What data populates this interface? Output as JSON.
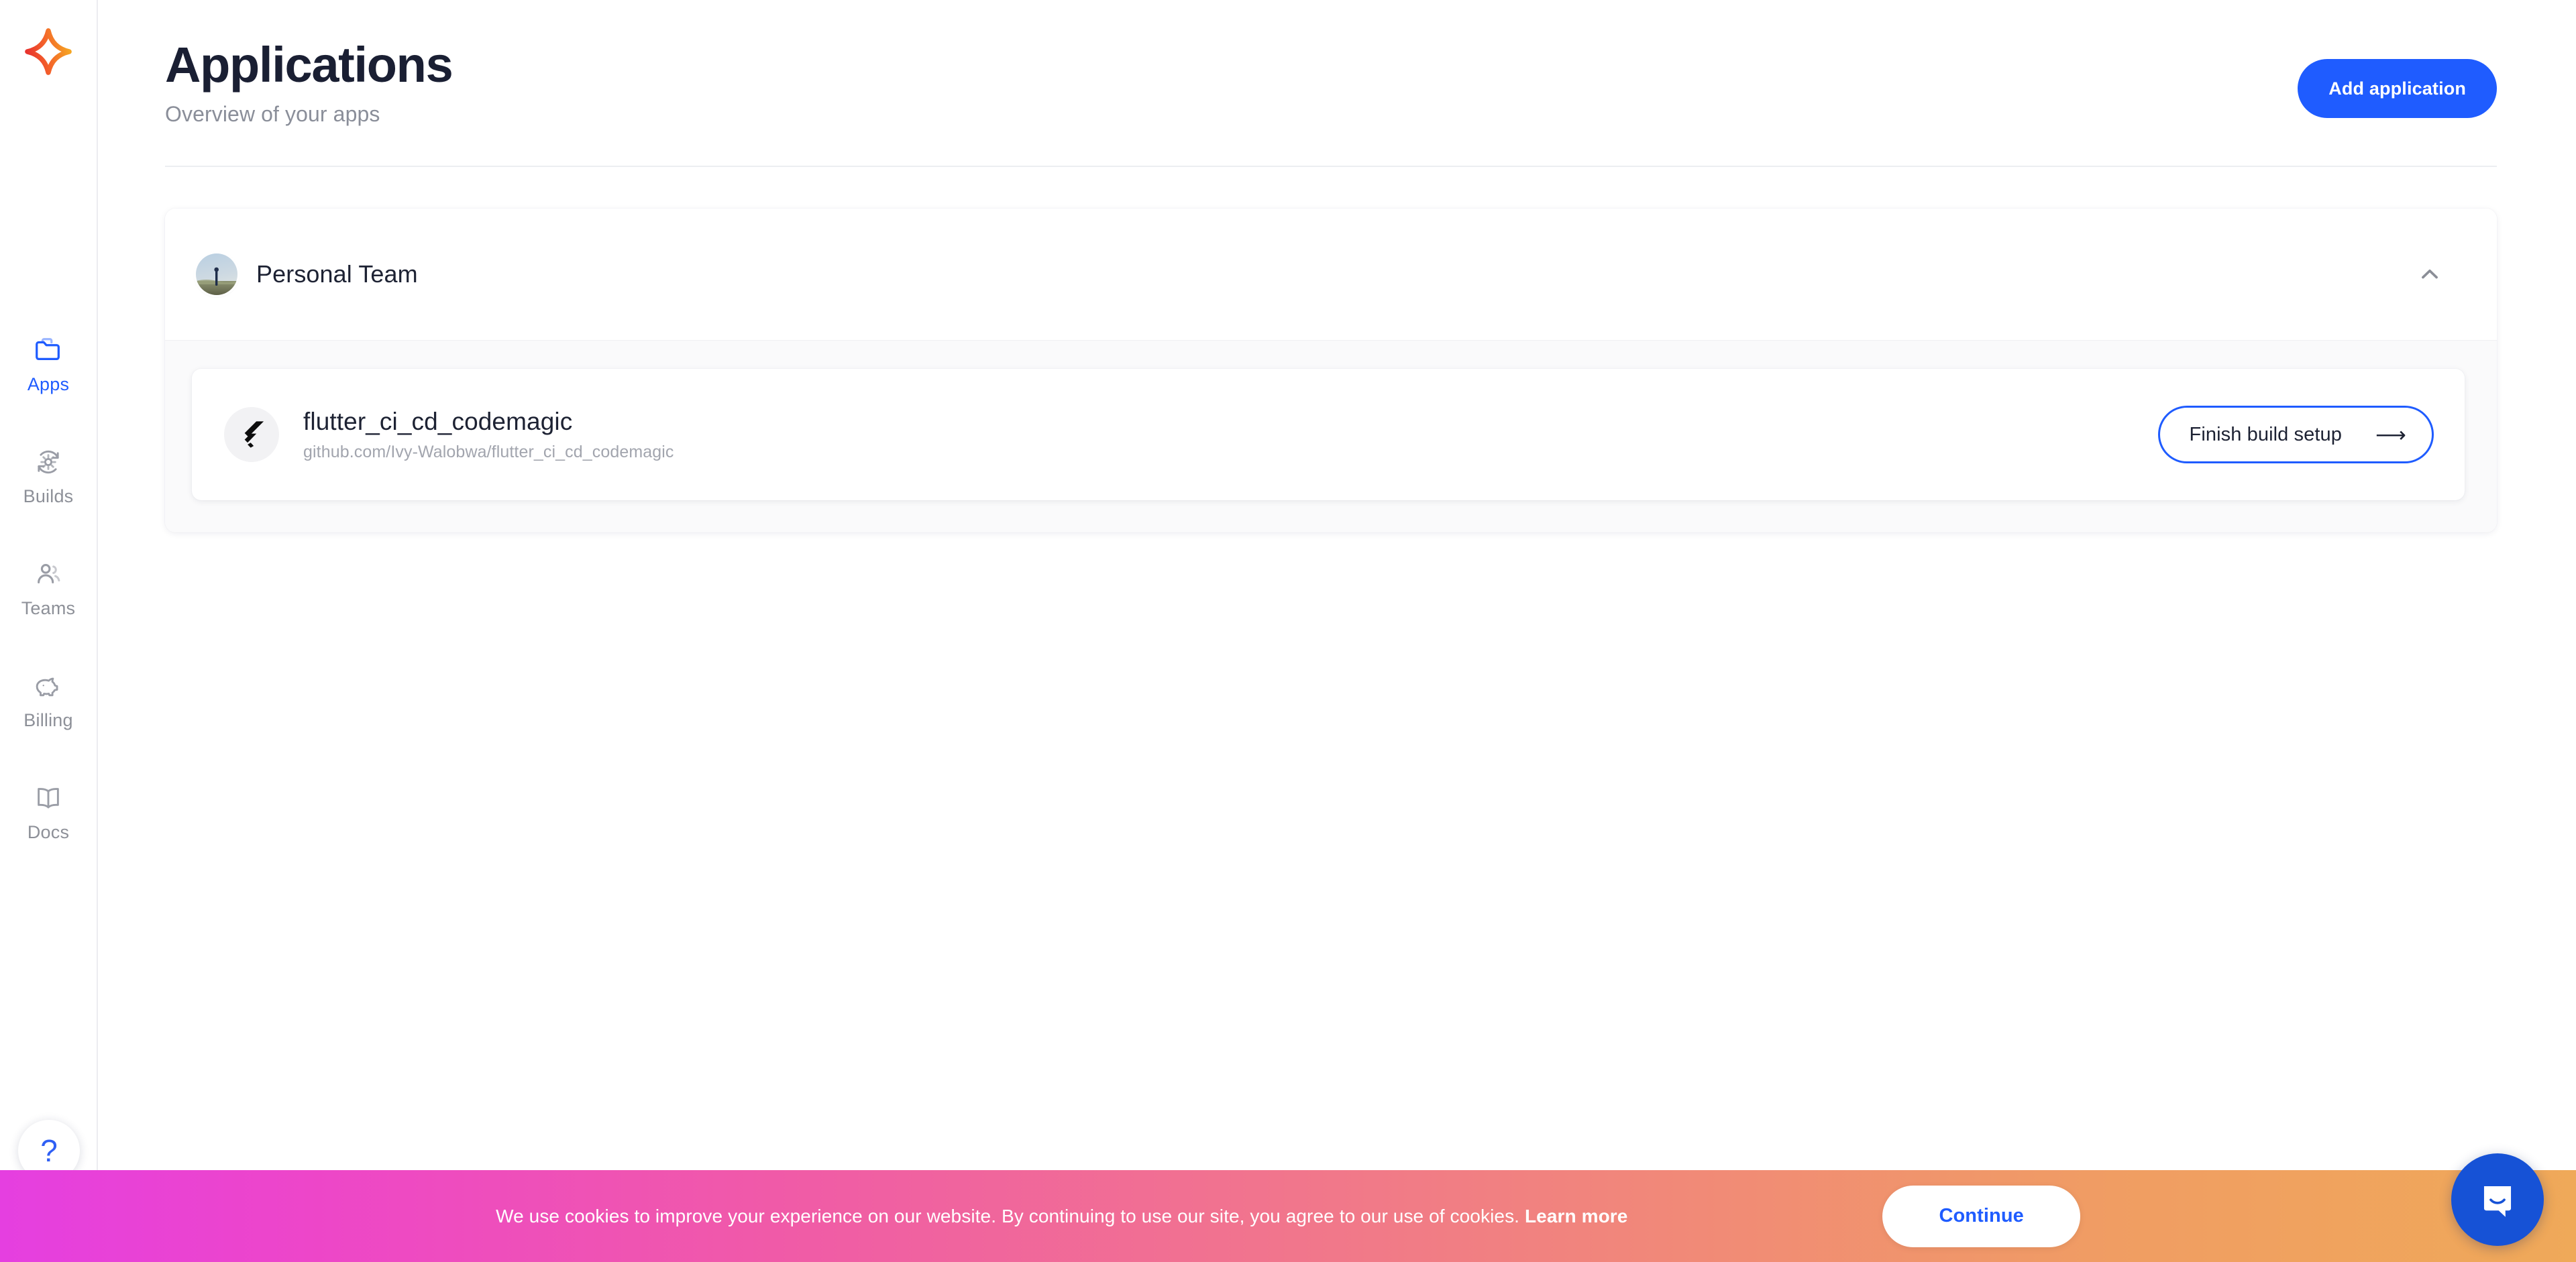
{
  "brand": {
    "logo_icon": "codemagic-star-logo",
    "colors": {
      "accent": "#1f5cff",
      "logo_start": "#e8342e",
      "logo_end": "#f5a623"
    }
  },
  "sidebar": {
    "items": [
      {
        "label": "Apps",
        "icon": "folder-icon",
        "active": true
      },
      {
        "label": "Builds",
        "icon": "gear-cycle-icon",
        "active": false
      },
      {
        "label": "Teams",
        "icon": "people-icon",
        "active": false
      },
      {
        "label": "Billing",
        "icon": "piggy-bank-icon",
        "active": false
      },
      {
        "label": "Docs",
        "icon": "open-book-icon",
        "active": false
      }
    ],
    "help": {
      "label": "?",
      "icon": "question-mark-icon"
    }
  },
  "header": {
    "title": "Applications",
    "subtitle": "Overview of your apps",
    "add_application_label": "Add application"
  },
  "teams": [
    {
      "name": "Personal Team",
      "avatar_icon": "team-avatar-photo",
      "expanded": true,
      "collapse_icon": "chevron-up-icon",
      "apps": [
        {
          "name": "flutter_ci_cd_codemagic",
          "repository_url": "github.com/Ivy-Walobwa/flutter_ci_cd_codemagic",
          "logo_icon": "flutter-icon",
          "action_label": "Finish build setup",
          "action_icon": "arrow-right-icon"
        }
      ]
    }
  ],
  "cookie_banner": {
    "message": "We use cookies to improve your experience on our website. By continuing to use our site, you agree to our use of cookies.",
    "link_label": "Learn more",
    "continue_label": "Continue"
  },
  "chat_widget": {
    "icon": "intercom-chat-icon"
  }
}
